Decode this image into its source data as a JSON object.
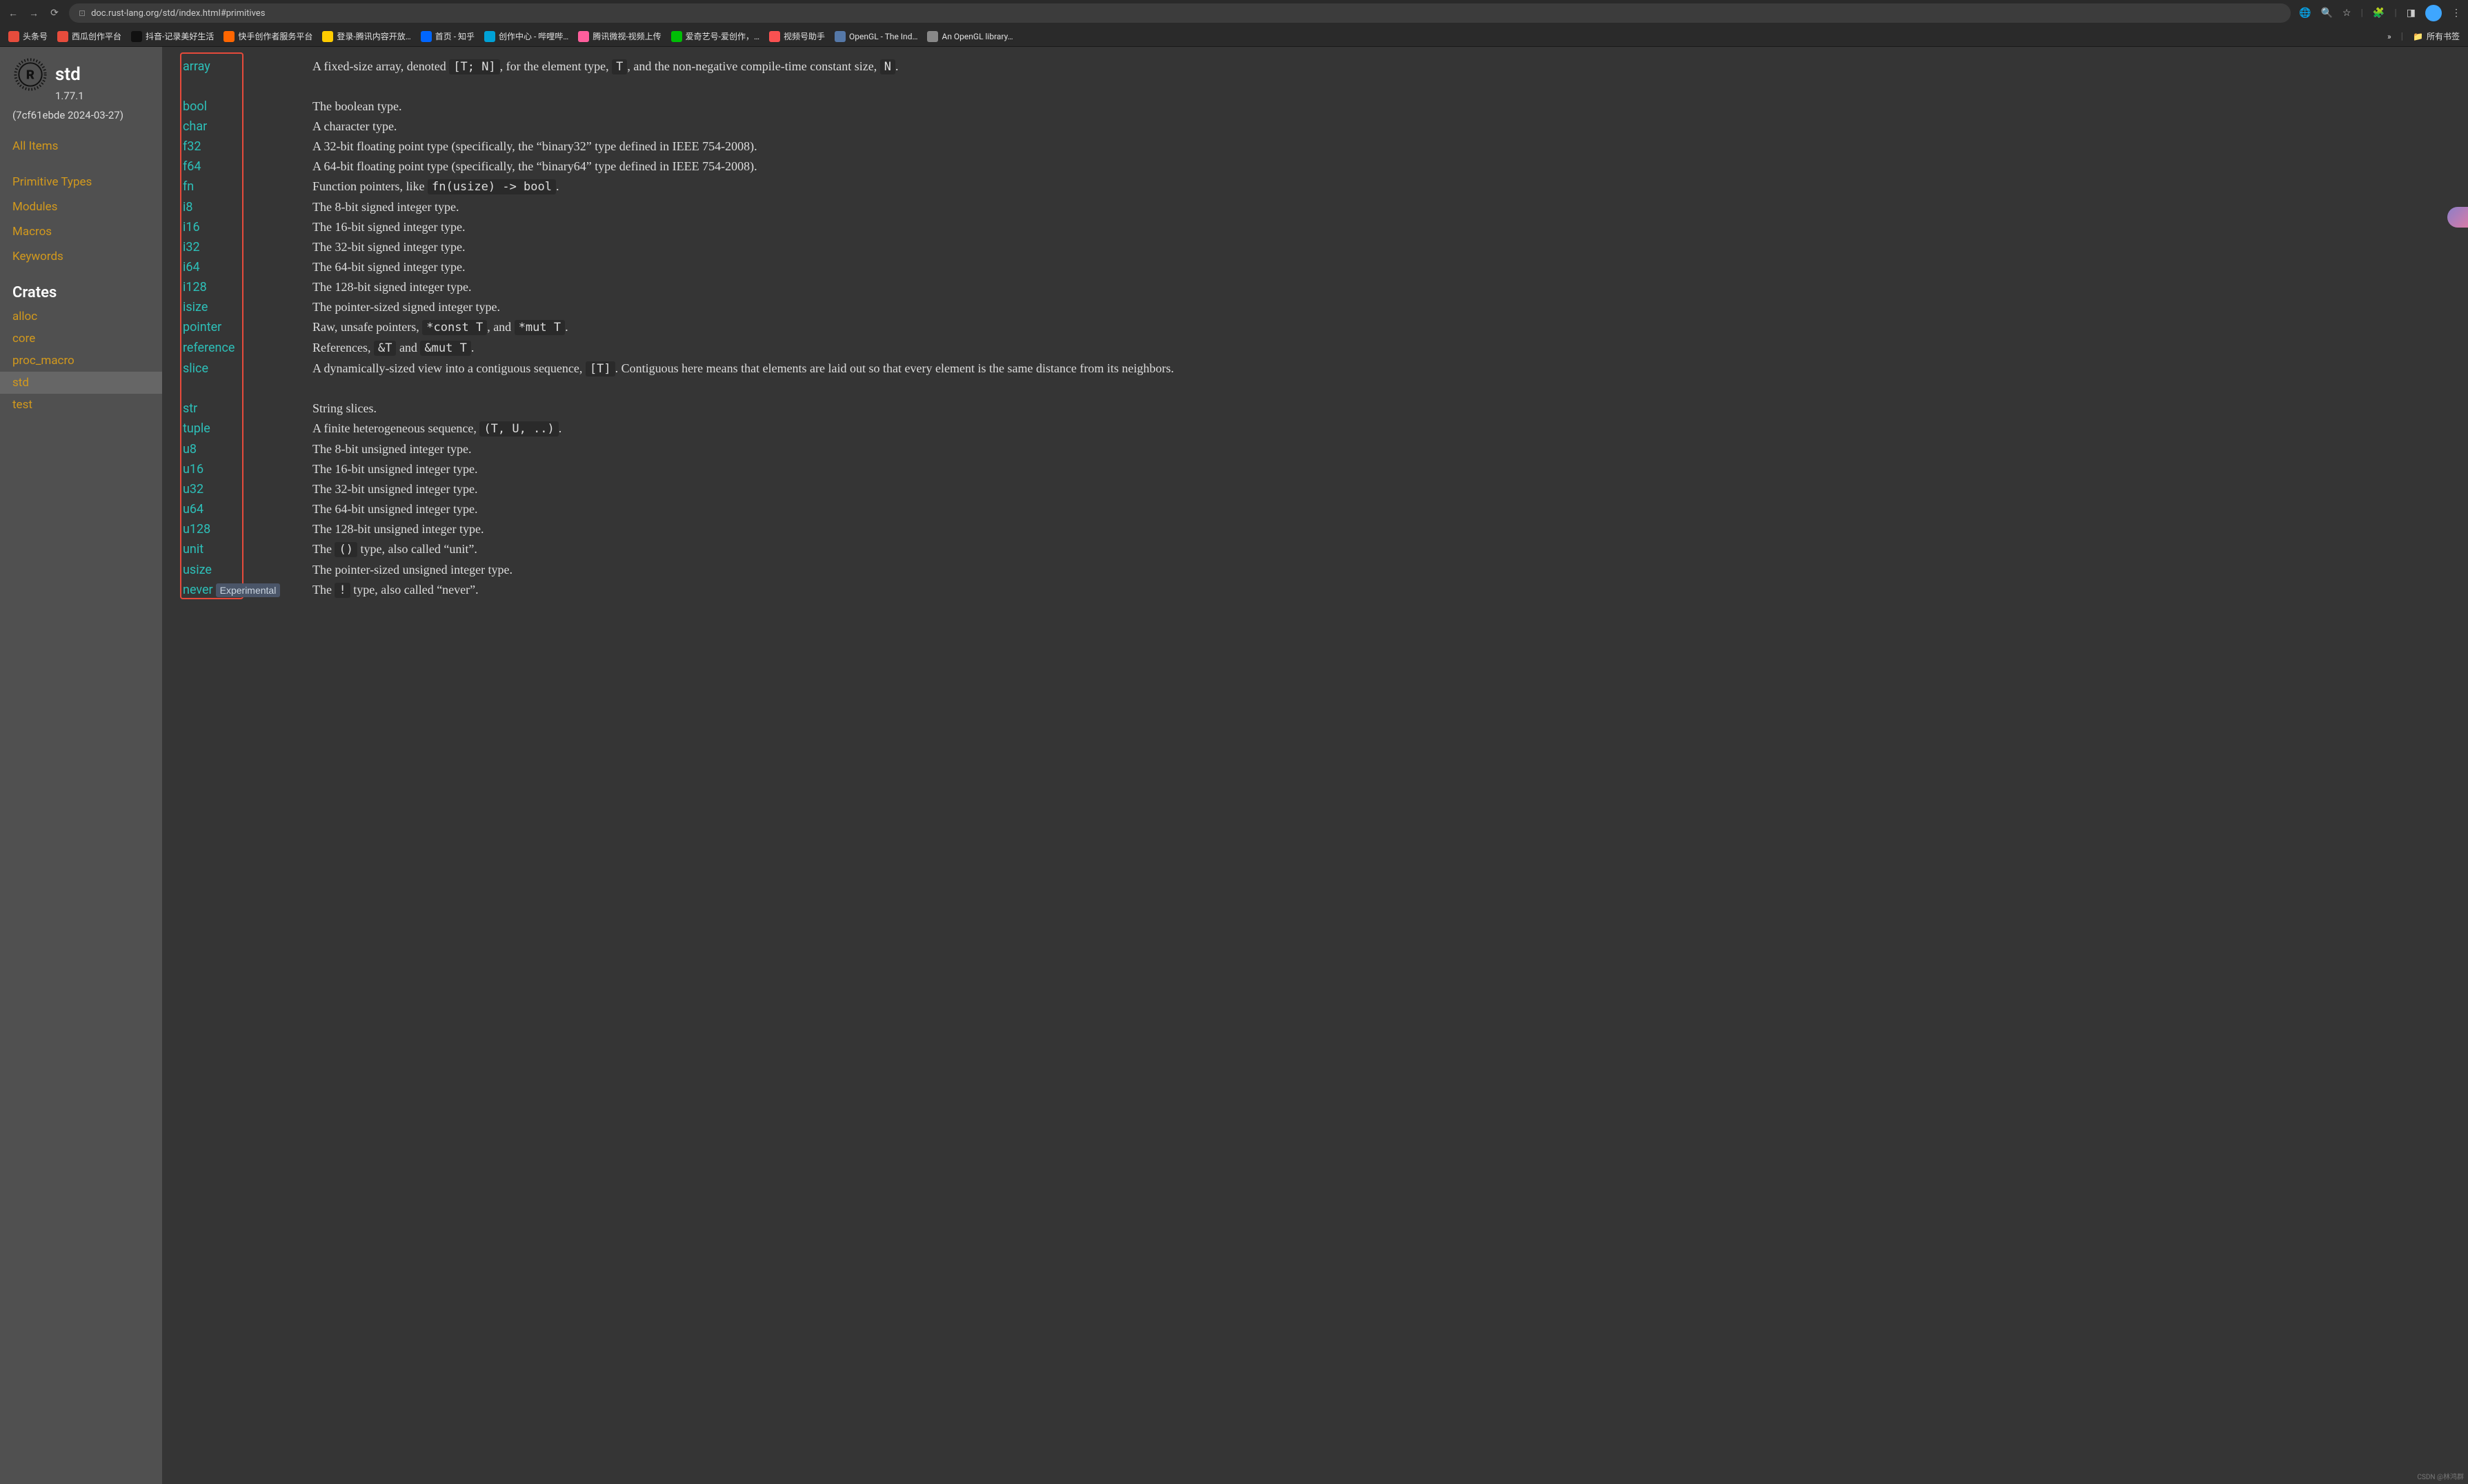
{
  "browser": {
    "url": "doc.rust-lang.org/std/index.html#primitives",
    "bookmarks": [
      {
        "label": "头条号",
        "color": "#e74c3c"
      },
      {
        "label": "西瓜创作平台",
        "color": "#e74c3c"
      },
      {
        "label": "抖音-记录美好生活",
        "color": "#111"
      },
      {
        "label": "快手创作者服务平台",
        "color": "#ff6600"
      },
      {
        "label": "登录-腾讯内容开放…",
        "color": "#ffcc00"
      },
      {
        "label": "首页 - 知乎",
        "color": "#0066ff"
      },
      {
        "label": "创作中心 - 哔哩哔…",
        "color": "#00a1d6"
      },
      {
        "label": "腾讯微视-视频上传",
        "color": "#ff5e9c"
      },
      {
        "label": "爱奇艺号-爱创作，…",
        "color": "#00be06"
      },
      {
        "label": "视频号助手",
        "color": "#fa5151"
      },
      {
        "label": "OpenGL - The Ind…",
        "color": "#5578a8"
      },
      {
        "label": "An OpenGL library…",
        "color": "#888"
      }
    ],
    "overflow": "»",
    "all_bookmarks": "所有书签"
  },
  "sidebar": {
    "crate": "std",
    "version": "1.77.1",
    "hash": "(7cf61ebde 2024-03-27)",
    "all_items": "All Items",
    "nav": [
      "Primitive Types",
      "Modules",
      "Macros",
      "Keywords"
    ],
    "crates_title": "Crates",
    "crates": [
      {
        "name": "alloc",
        "active": false
      },
      {
        "name": "core",
        "active": false
      },
      {
        "name": "proc_macro",
        "active": false
      },
      {
        "name": "std",
        "active": true
      },
      {
        "name": "test",
        "active": false
      }
    ]
  },
  "primitives": [
    {
      "name": "array",
      "desc": [
        "A fixed-size array, denoted ",
        {
          "code": "[T; N]"
        },
        ", for the element type, ",
        {
          "code": "T"
        },
        ", and the non-negative compile-time constant size, ",
        {
          "code": "N"
        },
        "."
      ],
      "tall": true
    },
    {
      "name": "bool",
      "desc": [
        "The boolean type."
      ]
    },
    {
      "name": "char",
      "desc": [
        "A character type."
      ]
    },
    {
      "name": "f32",
      "desc": [
        "A 32-bit floating point type (specifically, the “binary32” type defined in IEEE 754-2008)."
      ]
    },
    {
      "name": "f64",
      "desc": [
        "A 64-bit floating point type (specifically, the “binary64” type defined in IEEE 754-2008)."
      ]
    },
    {
      "name": "fn",
      "desc": [
        "Function pointers, like ",
        {
          "code": "fn(usize) -> bool"
        },
        "."
      ]
    },
    {
      "name": "i8",
      "desc": [
        "The 8-bit signed integer type."
      ]
    },
    {
      "name": "i16",
      "desc": [
        "The 16-bit signed integer type."
      ]
    },
    {
      "name": "i32",
      "desc": [
        "The 32-bit signed integer type."
      ]
    },
    {
      "name": "i64",
      "desc": [
        "The 64-bit signed integer type."
      ]
    },
    {
      "name": "i128",
      "desc": [
        "The 128-bit signed integer type."
      ]
    },
    {
      "name": "isize",
      "desc": [
        "The pointer-sized signed integer type."
      ]
    },
    {
      "name": "pointer",
      "desc": [
        "Raw, unsafe pointers, ",
        {
          "code": "*const T"
        },
        ", and ",
        {
          "code": "*mut T"
        },
        "."
      ]
    },
    {
      "name": "reference",
      "desc": [
        "References, ",
        {
          "code": "&T"
        },
        " and ",
        {
          "code": "&mut T"
        },
        "."
      ]
    },
    {
      "name": "slice",
      "desc": [
        "A dynamically-sized view into a contiguous sequence, ",
        {
          "code": "[T]"
        },
        ". Contiguous here means that elements are laid out so that every element is the same distance from its neighbors."
      ],
      "tall": true
    },
    {
      "name": "str",
      "desc": [
        "String slices."
      ]
    },
    {
      "name": "tuple",
      "desc": [
        "A finite heterogeneous sequence, ",
        {
          "code": "(T, U, ..)"
        },
        "."
      ]
    },
    {
      "name": "u8",
      "desc": [
        "The 8-bit unsigned integer type."
      ]
    },
    {
      "name": "u16",
      "desc": [
        "The 16-bit unsigned integer type."
      ]
    },
    {
      "name": "u32",
      "desc": [
        "The 32-bit unsigned integer type."
      ]
    },
    {
      "name": "u64",
      "desc": [
        "The 64-bit unsigned integer type."
      ]
    },
    {
      "name": "u128",
      "desc": [
        "The 128-bit unsigned integer type."
      ]
    },
    {
      "name": "unit",
      "desc": [
        "The ",
        {
          "code": "()"
        },
        " type, also called “unit”."
      ]
    },
    {
      "name": "usize",
      "desc": [
        "The pointer-sized unsigned integer type."
      ]
    },
    {
      "name": "never",
      "badge": "Experimental",
      "desc": [
        "The ",
        {
          "code": "!"
        },
        " type, also called “never”."
      ]
    }
  ],
  "watermark": "CSDN @林鸿群"
}
